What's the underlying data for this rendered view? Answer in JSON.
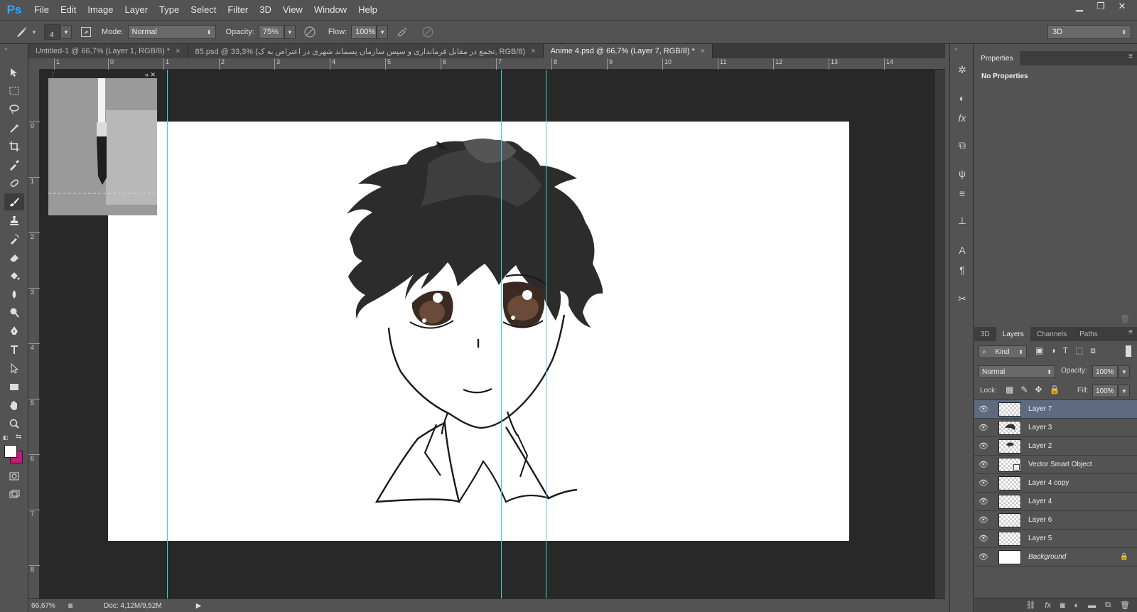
{
  "app": {
    "logo": "Ps"
  },
  "menu": [
    "File",
    "Edit",
    "Image",
    "Layer",
    "Type",
    "Select",
    "Filter",
    "3D",
    "View",
    "Window",
    "Help"
  ],
  "window_controls": [
    "▁",
    "❐",
    "✕"
  ],
  "options": {
    "brush_size": "4",
    "mode_label": "Mode:",
    "mode_value": "Normal",
    "opacity_label": "Opacity:",
    "opacity_value": "75%",
    "flow_label": "Flow:",
    "flow_value": "100%",
    "workspace": "3D"
  },
  "tabs": [
    {
      "label": "Untitled-1 @ 66,7% (Layer 1, RGB/8) *",
      "active": false
    },
    {
      "label": "85.psd @ 33,3% (تجمع در مقابل فرمانداری و سپس سازمان پسماند شهری در اعتراض به ک, RGB/8)",
      "active": false
    },
    {
      "label": "Anime 4.psd @ 66,7% (Layer 7, RGB/8) *",
      "active": true
    }
  ],
  "ruler_h": [
    "1",
    "0",
    "1",
    "2",
    "3",
    "4",
    "5",
    "6",
    "7",
    "8",
    "9",
    "10",
    "11",
    "12",
    "13",
    "14"
  ],
  "ruler_v": [
    "0",
    "1",
    "2",
    "3",
    "4",
    "5",
    "6",
    "7",
    "8"
  ],
  "status": {
    "zoom": "66,67%",
    "doc": "Doc: 4,12M/9,52M"
  },
  "properties": {
    "tab": "Properties",
    "message": "No Properties"
  },
  "layers_panel": {
    "tabs": [
      "3D",
      "Layers",
      "Channels",
      "Paths"
    ],
    "active_tab": "Layers",
    "kind_label": "Kind",
    "blend_mode": "Normal",
    "opacity_label": "Opacity:",
    "opacity_value": "100%",
    "lock_label": "Lock:",
    "fill_label": "Fill:",
    "fill_value": "100%",
    "layers": [
      {
        "name": "Layer 7",
        "selected": true,
        "thumb": "empty"
      },
      {
        "name": "Layer 3",
        "selected": false,
        "thumb": "hair"
      },
      {
        "name": "Layer 2",
        "selected": false,
        "thumb": "face"
      },
      {
        "name": "Vector Smart Object",
        "selected": false,
        "thumb": "smart"
      },
      {
        "name": "Layer 4 copy",
        "selected": false,
        "thumb": "empty"
      },
      {
        "name": "Layer 4",
        "selected": false,
        "thumb": "empty"
      },
      {
        "name": "Layer 6",
        "selected": false,
        "thumb": "empty"
      },
      {
        "name": "Layer 5",
        "selected": false,
        "thumb": "empty"
      },
      {
        "name": "Background",
        "selected": false,
        "thumb": "white",
        "locked": true
      }
    ]
  },
  "colors": {
    "ui_bg": "#535353",
    "pasteboard": "#282828",
    "guide": "#3fd0d8",
    "foreground": "#ffffff",
    "background": "#c01a7a",
    "selected_layer": "#5d6a80"
  }
}
